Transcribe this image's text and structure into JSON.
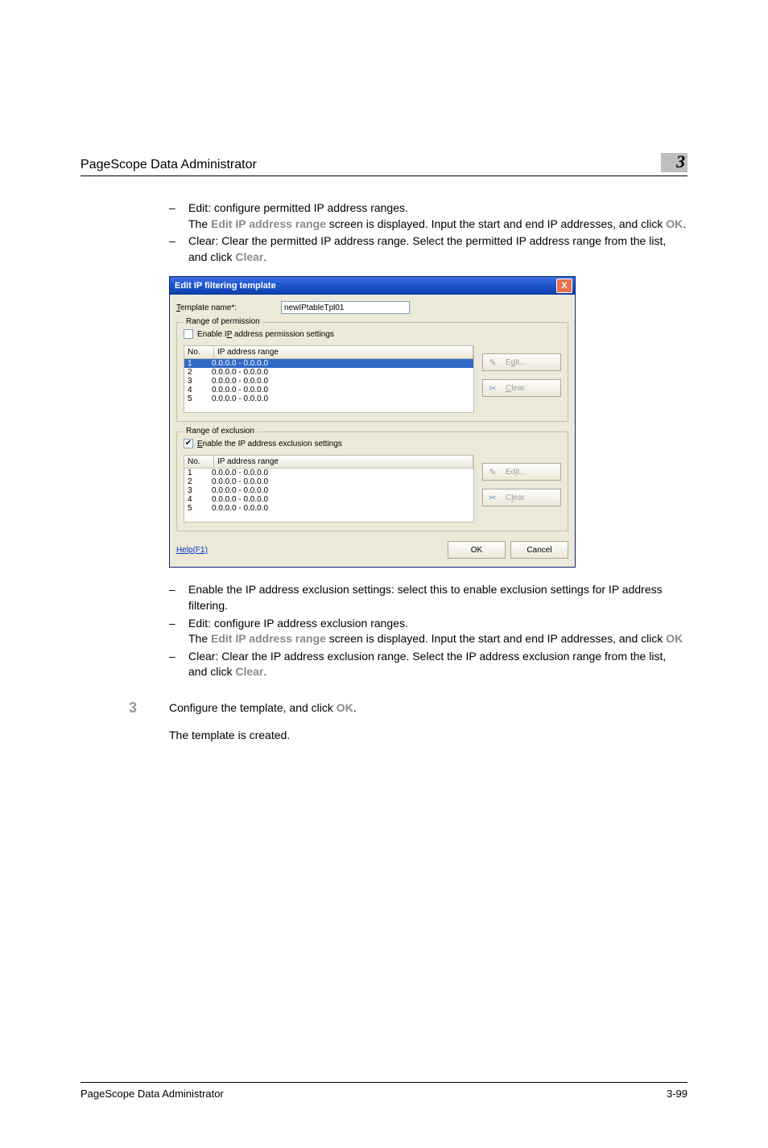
{
  "header": {
    "title": "PageScope Data Administrator",
    "chapter": "3"
  },
  "instructions_top": [
    {
      "lead": "Edit: configure permitted IP address ranges.",
      "cont": " The <kw>Edit IP address range</kw> screen is displayed. Input the start and end IP addresses, and click <kw>OK</kw>."
    },
    {
      "lead": "Clear: Clear the permitted IP address range. Select the permitted IP address range from the list, and click <kw>Clear</kw>.",
      "cont": ""
    }
  ],
  "dialog": {
    "title": "Edit IP filtering template",
    "close": "X",
    "template_name_label_pre": "T",
    "template_name_label_post": "emplate name*:",
    "template_name_value": "newIPtableTpl01",
    "permission": {
      "legend": "Range of permission",
      "chk_checked": false,
      "chk_label_pre": "Enable I",
      "chk_label_ul": "P",
      "chk_label_post": " address permission settings",
      "header_no": "No.",
      "header_range": "IP address range",
      "rows": [
        {
          "no": "1",
          "range": "0.0.0.0 - 0.0.0.0",
          "sel": true
        },
        {
          "no": "2",
          "range": "0.0.0.0 - 0.0.0.0",
          "sel": false
        },
        {
          "no": "3",
          "range": "0.0.0.0 - 0.0.0.0",
          "sel": false
        },
        {
          "no": "4",
          "range": "0.0.0.0 - 0.0.0.0",
          "sel": false
        },
        {
          "no": "5",
          "range": "0.0.0.0 - 0.0.0.0",
          "sel": false
        }
      ],
      "edit_pre": "E",
      "edit_ul": "d",
      "edit_post": "it...",
      "clear_pre": "",
      "clear_ul": "C",
      "clear_post": "lear"
    },
    "exclusion": {
      "legend": "Range of exclusion",
      "chk_checked": true,
      "chk_label_pre": "",
      "chk_label_ul": "E",
      "chk_label_post": "nable the IP address exclusion settings",
      "header_no": "No.",
      "header_range": "IP address range",
      "rows": [
        {
          "no": "1",
          "range": "0.0.0.0 - 0.0.0.0",
          "sel": false
        },
        {
          "no": "2",
          "range": "0.0.0.0 - 0.0.0.0",
          "sel": false
        },
        {
          "no": "3",
          "range": "0.0.0.0 - 0.0.0.0",
          "sel": false
        },
        {
          "no": "4",
          "range": "0.0.0.0 - 0.0.0.0",
          "sel": false
        },
        {
          "no": "5",
          "range": "0.0.0.0 - 0.0.0.0",
          "sel": false
        }
      ],
      "edit_pre": "Ed",
      "edit_ul": "i",
      "edit_post": "t...",
      "clear_pre": "C",
      "clear_ul": "l",
      "clear_post": "ear"
    },
    "help": "Help(F1)",
    "ok": "OK",
    "cancel": "Cancel"
  },
  "instructions_bottom": [
    {
      "lead": "Enable the IP address exclusion settings: select this to enable exclusion settings for IP address filtering.",
      "cont": ""
    },
    {
      "lead": "Edit: configure IP address exclusion ranges.",
      "cont": "The <kw>Edit IP address range</kw> screen is displayed. Input the start and end IP addresses, and click <kw>OK</kw>"
    },
    {
      "lead": "Clear: Clear the IP address exclusion range. Select the IP address exclusion range from the list, and click <kw>Clear</kw>.",
      "cont": ""
    }
  ],
  "step3": {
    "num": "3",
    "line1": "Configure the template, and click <kw>OK</kw>.",
    "line2": "The template is created."
  },
  "footer": {
    "left": "PageScope Data Administrator",
    "right": "3-99"
  }
}
